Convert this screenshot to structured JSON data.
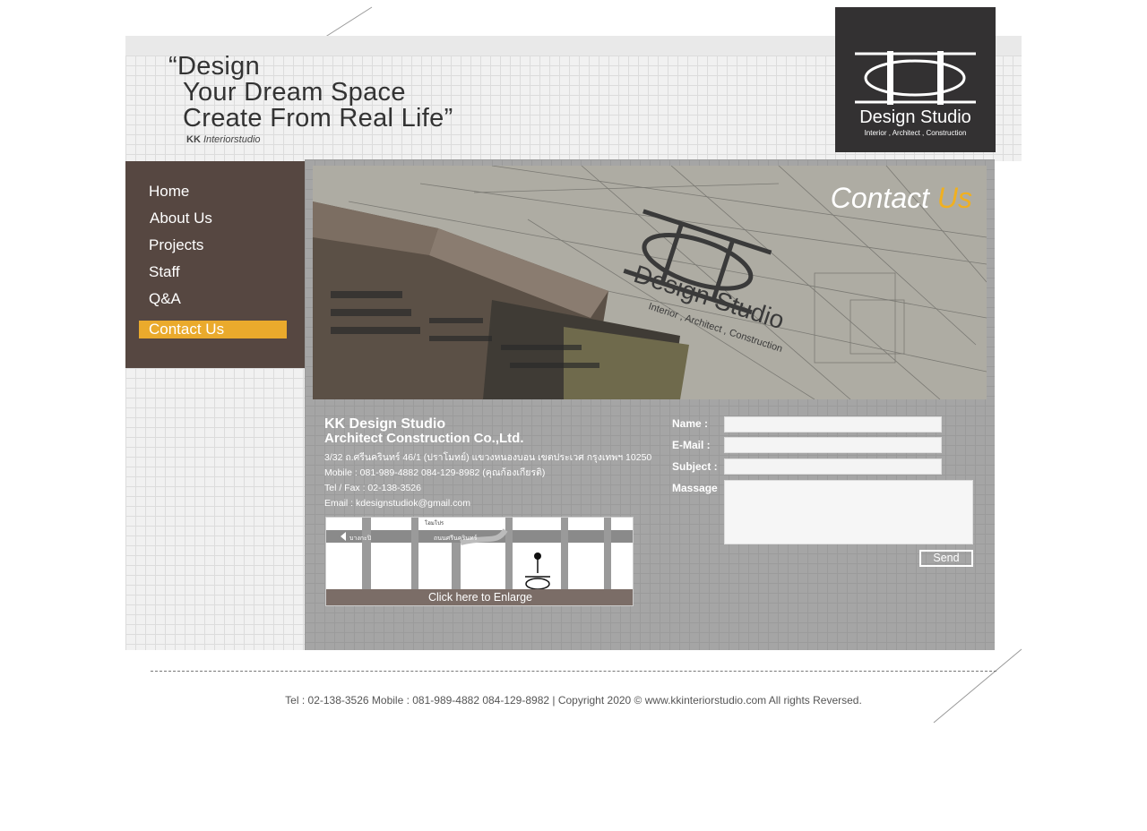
{
  "header": {
    "slogan_line1": "“Design",
    "slogan_line2": "Your Dream Space",
    "slogan_line3": "Create From Real Life”",
    "slogan_brand_kk": "KK",
    "slogan_brand_rest": " Interiorstudio"
  },
  "logo": {
    "name": "Design Studio",
    "tagline": "Interior , Architect , Construction"
  },
  "nav": {
    "items": [
      "Home",
      "About Us",
      "Projects",
      "Staff",
      "Q&A"
    ],
    "active": "Contact Us"
  },
  "banner": {
    "title_main": "Contact ",
    "title_highlight": "Us",
    "watermark_text": "Design Studio",
    "watermark_sub": "Interior , Architect , Construction",
    "highlight_color": "#f0b020"
  },
  "company": {
    "name_line1": "KK Design Studio",
    "name_line2": "Architect Construction Co.,Ltd.",
    "address": "3/32 ถ.ศรีนครินทร์ 46/1 (ปราโมทย์) แขวงหนองบอน เขตประเวศ กรุงเทพฯ 10250",
    "mobile": "Mobile : 081-989-4882 084-129-8982 (คุณก้องเกียรติ)",
    "telfax": "Tel / Fax : 02-138-3526",
    "email": "Email : kdesignstudiok@gmail.com"
  },
  "map": {
    "enlarge_label": "Click here to Enlarge",
    "label_1": "ถนนศรีนครินทร์",
    "label_2": "บางกะปิ",
    "label_3": "โฮมโปร"
  },
  "form": {
    "name_label": "Name :",
    "email_label": "E-Mail :",
    "subject_label": "Subject :",
    "message_label": "Massage",
    "send_label": "Send"
  },
  "footer": {
    "text": "Tel : 02-138-3526 Mobile : 081-989-4882 084-129-8982  |  Copyright 2020 © www.kkinteriorstudio.com All rights Reversed."
  }
}
